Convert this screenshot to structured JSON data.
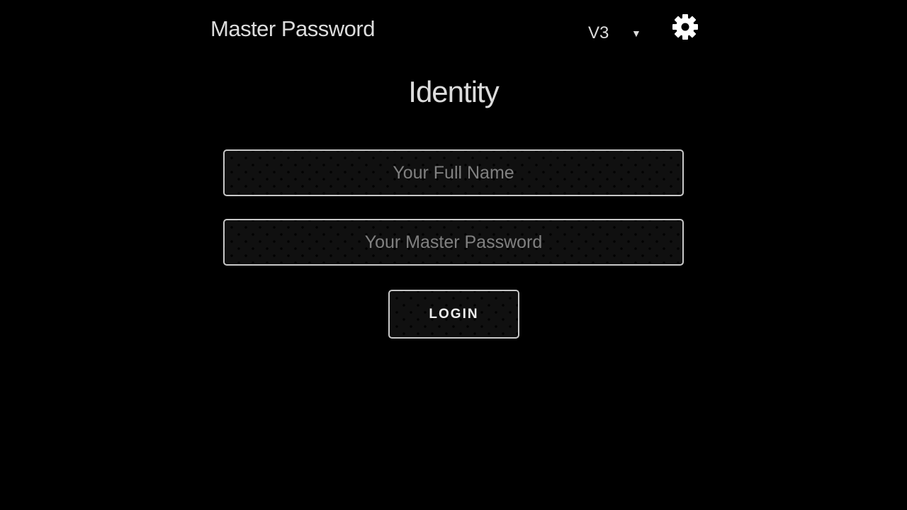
{
  "header": {
    "app_title": "Master Password",
    "version": {
      "selected": "V3",
      "icon": "chevron-down-icon"
    },
    "settings": {
      "icon": "gear-icon"
    }
  },
  "main": {
    "heading": "Identity",
    "full_name": {
      "value": "",
      "placeholder": "Your Full Name"
    },
    "master_password": {
      "value": "",
      "placeholder": "Your Master Password"
    },
    "login_label": "LOGIN"
  },
  "colors": {
    "background": "#000000",
    "text": "#dcdcdc",
    "placeholder": "#808080",
    "border": "#c8c8c8",
    "field_fill": "#101010"
  }
}
